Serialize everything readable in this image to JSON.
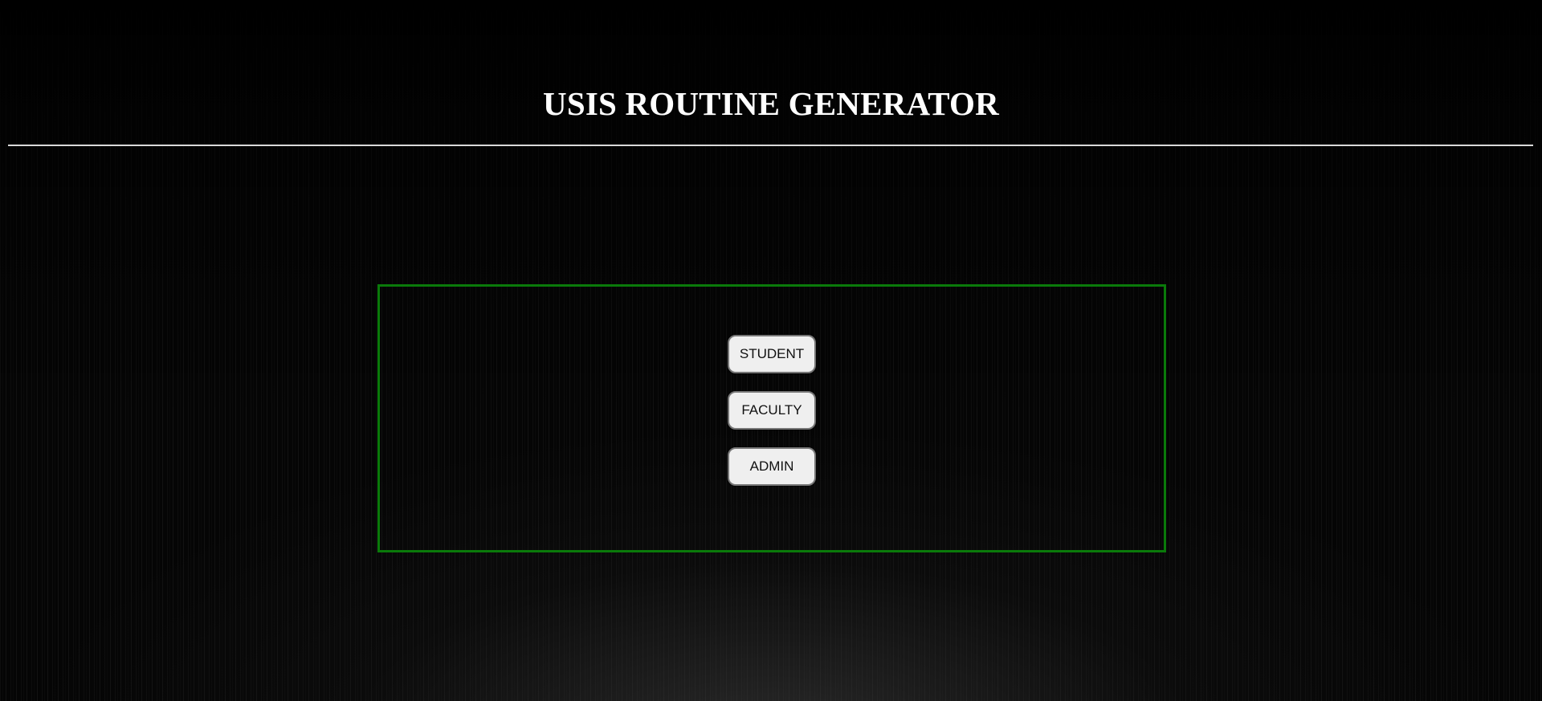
{
  "header": {
    "title": "USIS ROUTINE GENERATOR"
  },
  "role_panel": {
    "border_color": "#0a7a0a",
    "buttons": [
      {
        "label": "STUDENT"
      },
      {
        "label": "FACULTY"
      },
      {
        "label": "ADMIN"
      }
    ]
  },
  "colors": {
    "background": "#050505",
    "title_text": "#ffffff",
    "divider": "#d9d9d9",
    "button_background": "#efefef"
  }
}
